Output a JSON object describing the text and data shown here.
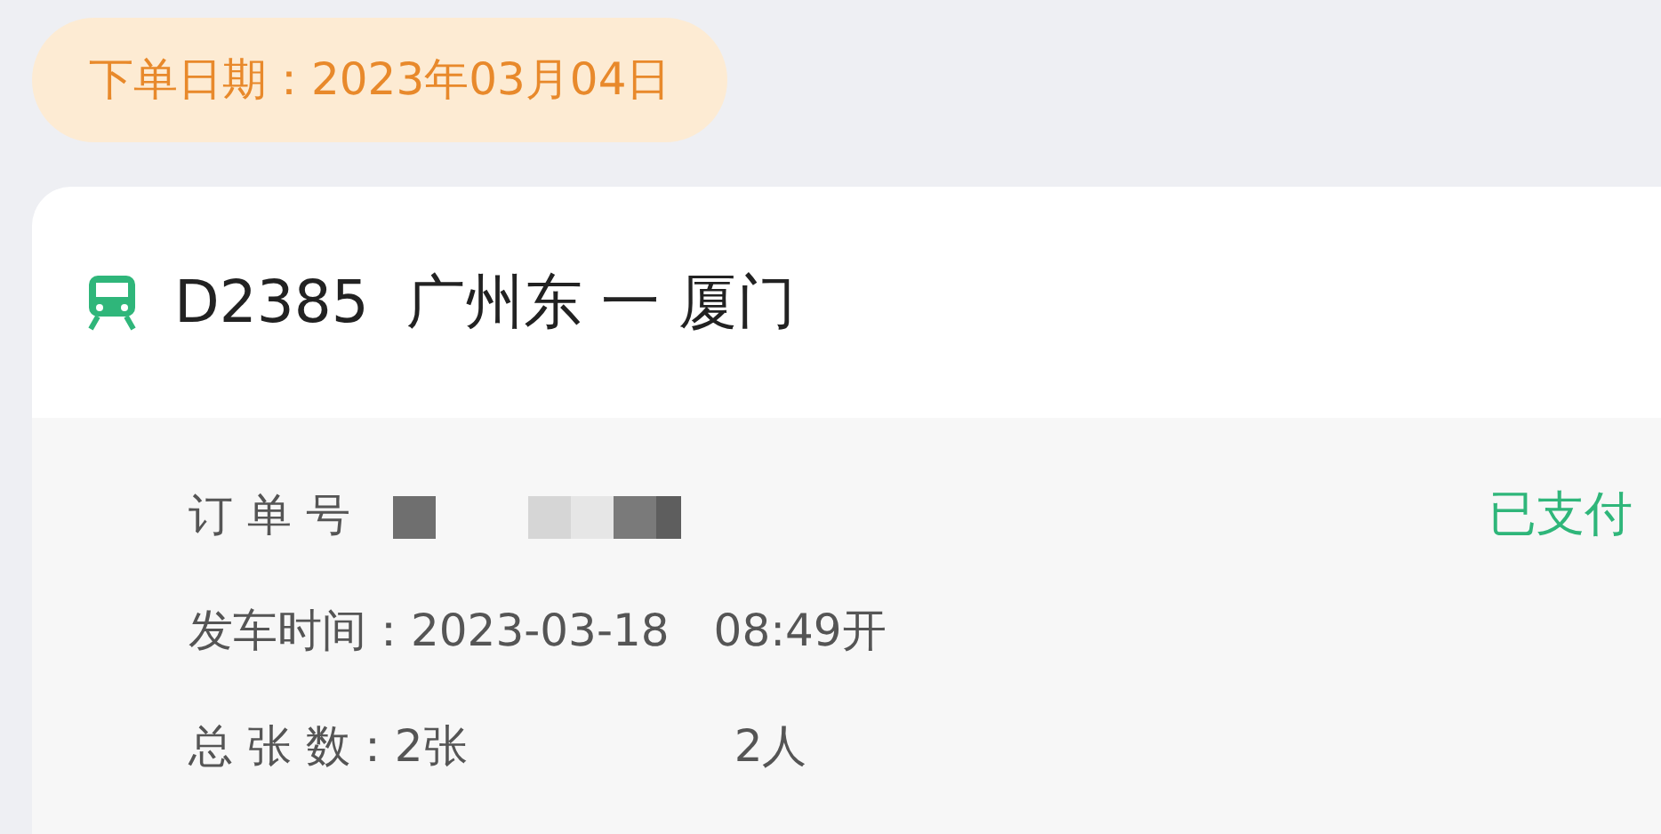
{
  "order_date": "下单日期：2023年03月04日",
  "trip": {
    "title": "D2385  广州东 一 厦门"
  },
  "details": [
    {
      "label": "订 单 号",
      "status": "已支付"
    },
    {
      "label": "发车时间：",
      "value": "2023-03-18　08:49开"
    },
    {
      "label": "总 张 数：",
      "value": "2张",
      "extra": "2人"
    }
  ]
}
